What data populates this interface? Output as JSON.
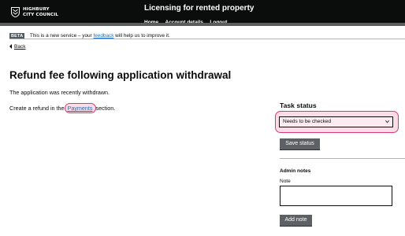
{
  "header": {
    "logo_line1": "HIGHBURY",
    "logo_line2": "CITY COUNCIL",
    "service_name": "Licensing for rented property",
    "nav": [
      "Home",
      "Account details",
      "Logout"
    ]
  },
  "banner": {
    "tag": "BETA",
    "text_before": "This is a new service – your ",
    "link": "feedback",
    "text_after": " will help us to improve it."
  },
  "back_link": "Back",
  "main": {
    "title": "Refund fee following application withdrawal",
    "paragraph1": "The application was recently withdrawn.",
    "paragraph2_before": "Create a refund in the ",
    "paragraph2_link": "Payments",
    "paragraph2_after": " section."
  },
  "sidebar": {
    "task_status_title": "Task status",
    "status_selected": "Needs to be checked",
    "save_button": "Save status",
    "admin_notes_title": "Admin notes",
    "note_label": "Note",
    "add_note_button": "Add note"
  },
  "colors": {
    "header_bg": "#0b0c0c",
    "link": "#1d70b8",
    "highlight_border": "#d63b78",
    "highlight_fill": "#fbdce7",
    "button_bg": "#5d6064"
  }
}
